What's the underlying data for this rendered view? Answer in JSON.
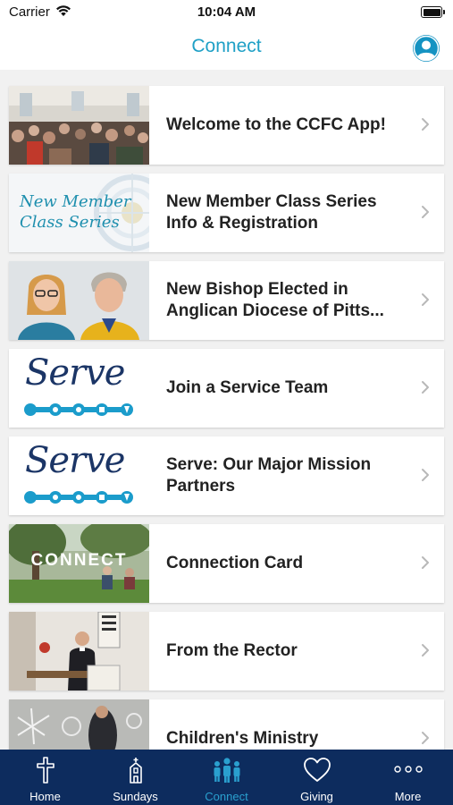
{
  "status_bar": {
    "carrier": "Carrier",
    "time": "10:04 AM"
  },
  "nav": {
    "title": "Connect",
    "profile_icon": "person-circle-icon"
  },
  "items": [
    {
      "label": "Welcome to the CCFC App!",
      "thumbnail": "congregation-photo"
    },
    {
      "label": "New Member Class Series Info & Registration",
      "thumbnail": "new-member-class-series-graphic",
      "thumb_text_line1": "New Member",
      "thumb_text_line2": "Class Series"
    },
    {
      "label": "New Bishop Elected in Anglican Diocese of Pitts...",
      "thumbnail": "bishop-couple-photo"
    },
    {
      "label": "Join a Service Team",
      "thumbnail": "serve-logo",
      "thumb_text": "Serve"
    },
    {
      "label": "Serve: Our Major Mission Partners",
      "thumbnail": "serve-logo",
      "thumb_text": "Serve"
    },
    {
      "label": "Connection Card",
      "thumbnail": "connect-photo",
      "thumb_text": "CONNECT"
    },
    {
      "label": "From the Rector",
      "thumbnail": "rector-pulpit-photo"
    },
    {
      "label": "Children's Ministry",
      "thumbnail": "chalk-drawing-photo"
    }
  ],
  "tabbar": [
    {
      "label": "Home",
      "icon": "cross-icon"
    },
    {
      "label": "Sundays",
      "icon": "church-icon"
    },
    {
      "label": "Connect",
      "icon": "people-icon",
      "active": true
    },
    {
      "label": "Giving",
      "icon": "heart-icon"
    },
    {
      "label": "More",
      "icon": "more-dots-icon"
    }
  ],
  "colors": {
    "accent": "#1fa0c6",
    "tabbar_bg": "#0d2c5e",
    "active_tab": "#2aa0cf",
    "serve_navy": "#1b3566",
    "serve_teal": "#1b9ccb"
  }
}
